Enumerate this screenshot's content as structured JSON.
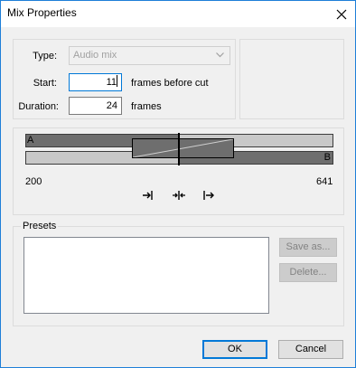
{
  "window": {
    "title": "Mix Properties"
  },
  "form": {
    "type_label": "Type:",
    "type_value": "Audio mix",
    "start_label": "Start:",
    "start_value": "11",
    "start_unit": "frames before cut",
    "duration_label": "Duration:",
    "duration_value": "24",
    "duration_unit": "frames"
  },
  "timeline": {
    "track_a_label": "A",
    "track_b_label": "B",
    "range_start": "200",
    "range_end": "641"
  },
  "presets": {
    "title": "Presets",
    "save_as_label": "Save as...",
    "delete_label": "Delete..."
  },
  "footer": {
    "ok_label": "OK",
    "cancel_label": "Cancel"
  },
  "icons": {
    "align_end": "align-end-icon",
    "align_center": "align-center-icon",
    "align_start": "align-start-icon",
    "close": "close-icon"
  }
}
